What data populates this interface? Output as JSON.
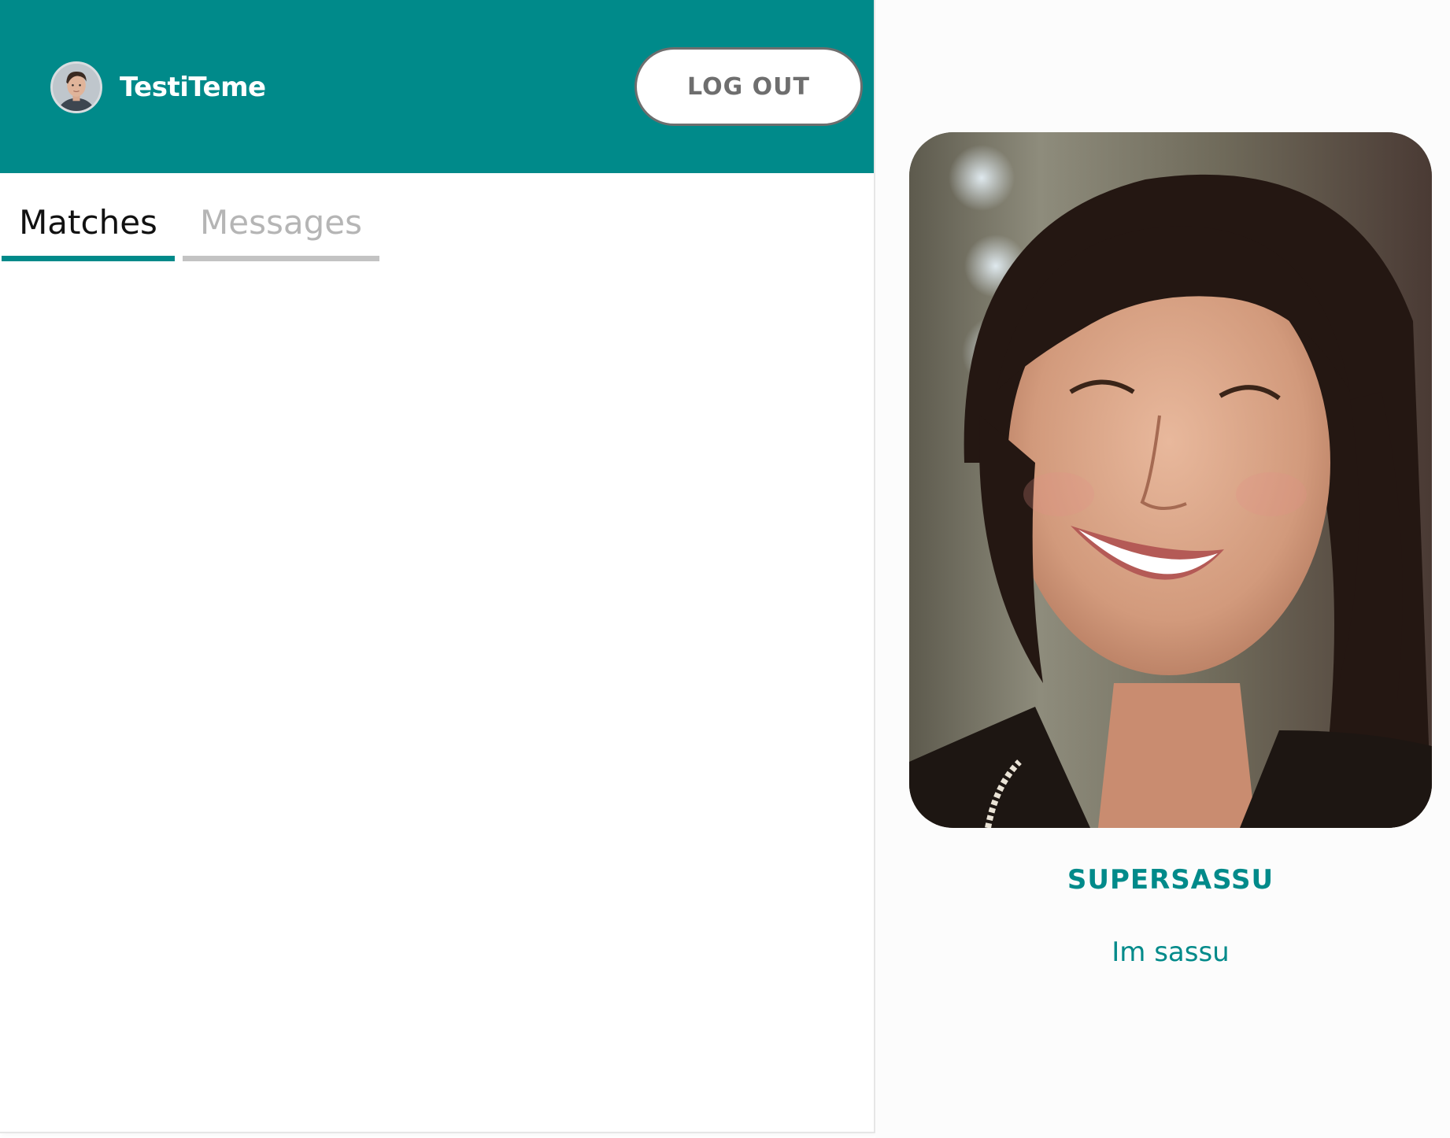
{
  "header": {
    "username": "TestiTeme",
    "avatar_icon": "user-avatar",
    "logout_label": "LOG OUT"
  },
  "tabs": [
    {
      "label": "Matches",
      "active": true
    },
    {
      "label": "Messages",
      "active": false
    }
  ],
  "matches": [],
  "profile_card": {
    "photo": "profile-photo",
    "name": "SUPERSASSU",
    "bio": "Im sassu"
  },
  "colors": {
    "brand": "#008a8a",
    "header_bg": "#008a8a",
    "active_tab_underline": "#008a8a",
    "inactive_tab_text": "#b5b5b5",
    "logout_text": "#6e6e6e"
  }
}
